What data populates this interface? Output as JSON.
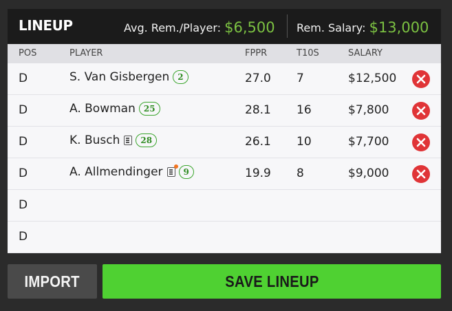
{
  "header": {
    "title": "LINEUP",
    "avg_label": "Avg. Rem./Player:",
    "avg_value": "$6,500",
    "rem_label": "Rem. Salary:",
    "rem_value": "$13,000"
  },
  "columns": {
    "pos": "POS",
    "player": "PLAYER",
    "fppr": "FPPR",
    "t10s": "T10S",
    "salary": "SALARY"
  },
  "rows": [
    {
      "pos": "D",
      "player": "S. Van Gisbergen",
      "number": "2",
      "news": false,
      "news_alert": false,
      "fppr": "27.0",
      "t10s": "7",
      "salary": "$12,500"
    },
    {
      "pos": "D",
      "player": "A. Bowman",
      "number": "25",
      "news": false,
      "news_alert": false,
      "fppr": "28.1",
      "t10s": "16",
      "salary": "$7,800"
    },
    {
      "pos": "D",
      "player": "K. Busch",
      "number": "28",
      "news": true,
      "news_alert": false,
      "fppr": "26.1",
      "t10s": "10",
      "salary": "$7,700"
    },
    {
      "pos": "D",
      "player": "A. Allmendinger",
      "number": "9",
      "news": true,
      "news_alert": true,
      "fppr": "19.9",
      "t10s": "8",
      "salary": "$9,000"
    },
    {
      "pos": "D"
    },
    {
      "pos": "D"
    }
  ],
  "icons": {
    "remove": "remove-player-icon",
    "news": "news-icon"
  },
  "colors": {
    "accent_green": "#7cc242",
    "save_button": "#4fd132",
    "remove_red": "#e03437"
  },
  "buttons": {
    "import": "IMPORT",
    "save": "SAVE LINEUP"
  }
}
